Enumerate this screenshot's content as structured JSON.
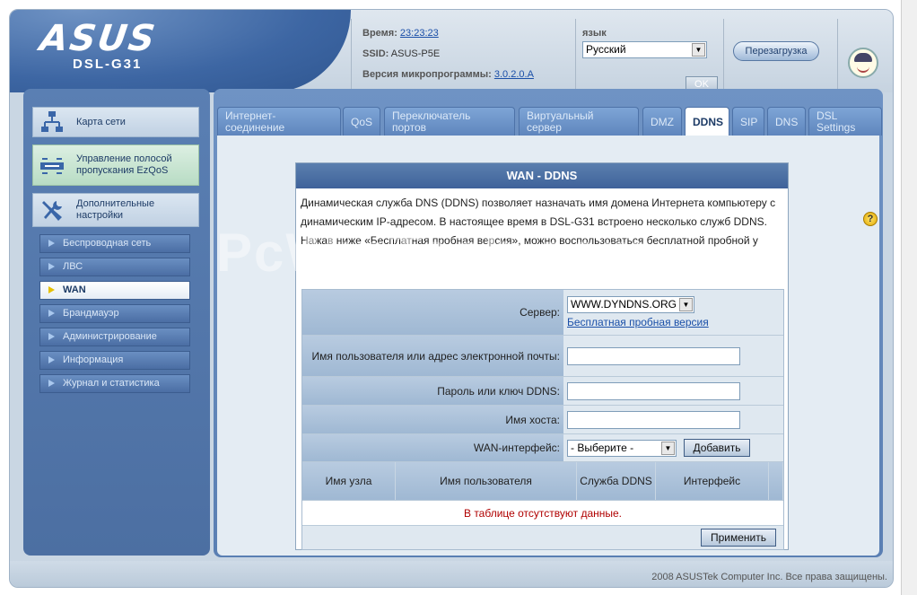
{
  "header": {
    "brand": "ASUS",
    "model": "DSL-G31",
    "time_label": "Время:",
    "time_value": "23:23:23",
    "ssid_label": "SSID:",
    "ssid_value": "ASUS-P5E",
    "firmware_label": "Версия микропрограммы:",
    "firmware_value": "3.0.2.0.A",
    "language_label": "язык",
    "language_value": "Русский",
    "ok_label": "OK",
    "reboot_label": "Перезагрузка"
  },
  "sidebar": {
    "big_items": [
      {
        "label": "Карта сети"
      },
      {
        "label": "Управление полосой пропускания EzQoS"
      },
      {
        "label": "Дополнительные настройки"
      }
    ],
    "sub_items": [
      {
        "label": "Беспроводная сеть"
      },
      {
        "label": "ЛВС"
      },
      {
        "label": "WAN"
      },
      {
        "label": "Брандмауэр"
      },
      {
        "label": "Администрирование"
      },
      {
        "label": "Информация"
      },
      {
        "label": "Журнал и статистика"
      }
    ]
  },
  "tabs": [
    {
      "label": "Интернет-соединение"
    },
    {
      "label": "QoS"
    },
    {
      "label": "Переключатель портов"
    },
    {
      "label": "Виртуальный сервер"
    },
    {
      "label": "DMZ"
    },
    {
      "label": "DDNS"
    },
    {
      "label": "SIP"
    },
    {
      "label": "DNS"
    },
    {
      "label": "DSL Settings"
    }
  ],
  "panel": {
    "title": "WAN - DDNS",
    "description": "Динамическая служба DNS (DDNS) позволяет назначать имя домена Интернета компьютеру с динамическим IP-адресом. В настоящее время в DSL-G31 встроено несколько служб DDNS. Нажав ниже «Бесплатная пробная версия», можно воспользоваться бесплатной пробной у",
    "server_label": "Сервер:",
    "server_value": "WWW.DYNDNS.ORG",
    "free_trial_link": "Бесплатная пробная версия",
    "username_label": "Имя пользователя или адрес электронной почты:",
    "username_value": "",
    "password_label": "Пароль или ключ DDNS:",
    "password_value": "",
    "hostname_label": "Имя хоста:",
    "hostname_value": "",
    "wan_if_label": "WAN-интерфейс:",
    "wan_if_value": "- Выберите -",
    "add_label": "Добавить",
    "table_headers": [
      "Имя узла",
      "Имя пользователя",
      "Служба DDNS",
      "Интерфейс"
    ],
    "empty_text": "В таблице отсутствуют данные.",
    "apply_label": "Применить"
  },
  "watermark": "PcWinTech.com",
  "footer": {
    "copyright": "2008 ASUSTek Computer Inc. Все права защищены."
  }
}
